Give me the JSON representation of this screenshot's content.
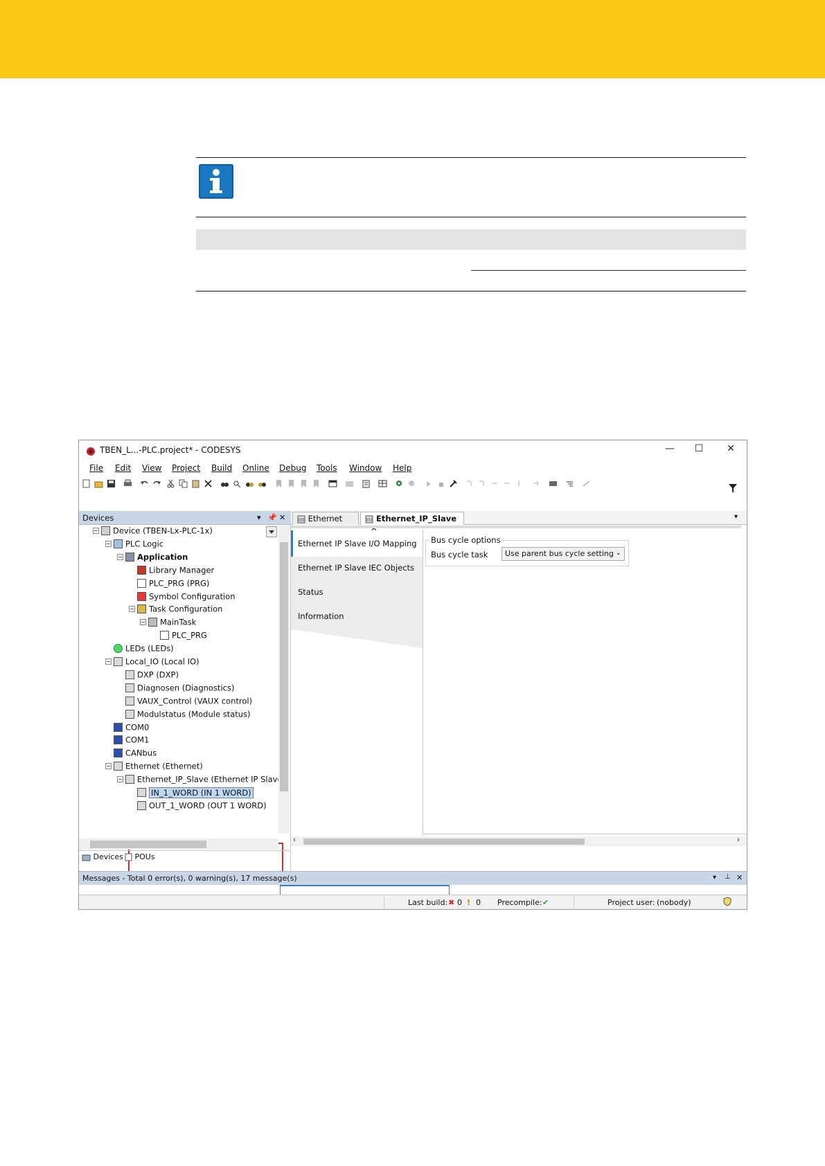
{
  "page": {
    "band_color": "#fcc715",
    "accent": "#1a78c2",
    "highlight": "#d32a2a"
  },
  "screenshot": {
    "window_title": "TBEN_L...-PLC.project* - CODESYS",
    "window_buttons": {
      "minimize": "—",
      "maximize": "☐",
      "close": "✕"
    },
    "menu": [
      "File",
      "Edit",
      "View",
      "Project",
      "Build",
      "Online",
      "Debug",
      "Tools",
      "Window",
      "Help"
    ],
    "devices_panel": {
      "title": "Devices",
      "tree": [
        {
          "label": "Device (TBEN-Lx-PLC-1x)",
          "icon": "device-icon",
          "toggle": "⊟"
        },
        {
          "label": "PLC Logic",
          "icon": "plc-logic-icon",
          "toggle": "⊟"
        },
        {
          "label": "Application",
          "icon": "application-icon",
          "toggle": "⊟",
          "bold": true
        },
        {
          "label": "Library Manager",
          "icon": "library-icon"
        },
        {
          "label": "PLC_PRG (PRG)",
          "icon": "program-icon"
        },
        {
          "label": "Symbol Configuration",
          "icon": "symbol-icon"
        },
        {
          "label": "Task Configuration",
          "icon": "task-config-icon",
          "toggle": "⊟"
        },
        {
          "label": "MainTask",
          "icon": "task-icon",
          "toggle": "⊟"
        },
        {
          "label": "PLC_PRG",
          "icon": "program-icon"
        },
        {
          "label": "LEDs (LEDs)",
          "icon": "led-icon"
        },
        {
          "label": "Local_IO (Local IO)",
          "icon": "io-module-icon",
          "toggle": "⊟"
        },
        {
          "label": "DXP (DXP)",
          "icon": "io-channel-icon"
        },
        {
          "label": "Diagnosen (Diagnostics)",
          "icon": "io-channel-icon"
        },
        {
          "label": "VAUX_Control (VAUX control)",
          "icon": "io-channel-icon"
        },
        {
          "label": "Modulstatus (Module status)",
          "icon": "io-channel-icon"
        },
        {
          "label": "COM0",
          "icon": "serial-port-icon"
        },
        {
          "label": "COM1",
          "icon": "serial-port-icon"
        },
        {
          "label": "CANbus",
          "icon": "serial-port-icon"
        },
        {
          "label": "Ethernet (Ethernet)",
          "icon": "io-module-icon",
          "toggle": "⊟"
        },
        {
          "label": "Ethernet_IP_Slave (Ethernet IP Slave)",
          "icon": "io-module-icon",
          "toggle": "⊟"
        },
        {
          "label": "IN_1_WORD (IN 1 WORD)",
          "icon": "io-module-icon",
          "selected": true
        },
        {
          "label": "OUT_1_WORD (OUT 1 WORD)",
          "icon": "io-module-icon"
        }
      ],
      "bottom_tabs": [
        "Devices",
        "POUs"
      ]
    },
    "editor": {
      "tabs": [
        {
          "label": "Ethernet",
          "active": false
        },
        {
          "label": "Ethernet_IP_Slave",
          "active": true
        }
      ],
      "tab_close": "✕",
      "nav": [
        "Ethernet IP Slave I/O Mapping",
        "Ethernet IP Slave IEC Objects",
        "Status",
        "Information"
      ],
      "group_title": "Bus cycle options",
      "field_label": "Bus cycle task",
      "field_value": "Use parent bus cycle setting"
    },
    "messages": "Messages - Total 0 error(s), 0 warning(s), 17 message(s)",
    "status": {
      "last_build_label": "Last build:",
      "errors": "0",
      "warnings": "0",
      "precompile_label": "Precompile:",
      "precompile_state": "✔",
      "project_user_label": "Project user:",
      "project_user": "(nobody)"
    }
  }
}
